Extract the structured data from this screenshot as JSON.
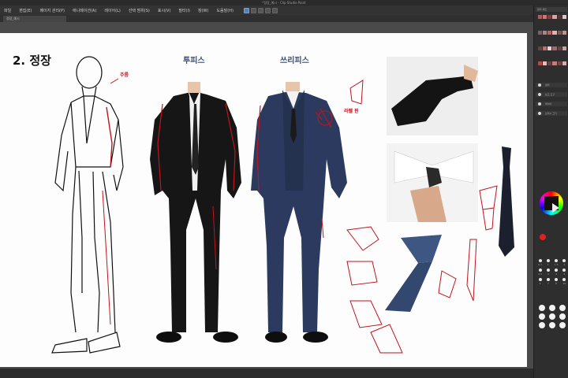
{
  "window": {
    "title": "*정장_예시 - Clip Studio Paint"
  },
  "menu": {
    "items": [
      "파일",
      "편집(E)",
      "페이지 관리(P)",
      "애니메이션(A)",
      "레이어(L)",
      "선택 범위(S)",
      "표시(V)",
      "필터(I)",
      "창(W)",
      "도움말(H)"
    ]
  },
  "document_tab": "정장_예시",
  "canvas": {
    "title": "2. 정장",
    "col_two_piece": "투피스",
    "col_three_piece": "쓰리피스",
    "note_wrinkle": "주름",
    "note_badge": "라펠 핀"
  },
  "right_panel": {
    "header": "컬러 세트",
    "props": [
      "컬러",
      "보조 도구",
      "레이어",
      "브러시 크기"
    ],
    "brush_sizes": [
      "0.7",
      "1",
      "1.5",
      "2",
      "2.5",
      "3",
      "4",
      "5",
      "6",
      "7",
      "8",
      "10"
    ]
  },
  "colors": {
    "accent": "#5a7fb5",
    "annotation_red": "#c0141c",
    "navy_suit": "#2b3a5e",
    "black_suit": "#161616"
  }
}
